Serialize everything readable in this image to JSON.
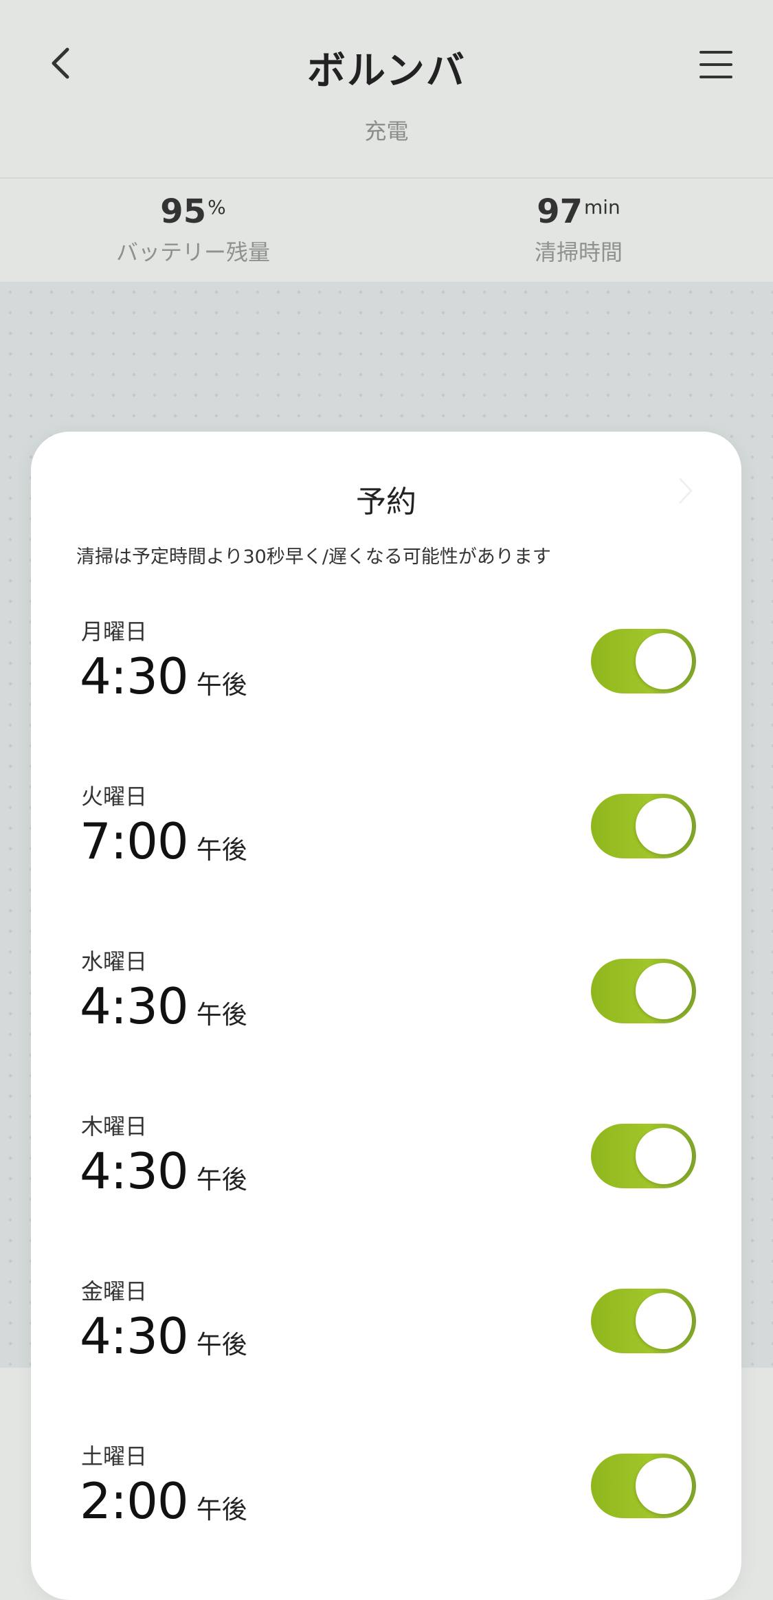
{
  "header": {
    "title": "ボルンバ",
    "subtitle": "充電"
  },
  "stats": {
    "battery": {
      "value": "95",
      "unit": "%",
      "label": "バッテリー残量"
    },
    "cleaning": {
      "value": "97",
      "unit": "min",
      "label": "清掃時間"
    }
  },
  "schedule": {
    "title": "予約",
    "note": "清掃は予定時間より30秒早く/遅くなる可能性があります",
    "items": [
      {
        "day": "月曜日",
        "time": "4:30",
        "ampm": "午後",
        "enabled": true
      },
      {
        "day": "火曜日",
        "time": "7:00",
        "ampm": "午後",
        "enabled": true
      },
      {
        "day": "水曜日",
        "time": "4:30",
        "ampm": "午後",
        "enabled": true
      },
      {
        "day": "木曜日",
        "time": "4:30",
        "ampm": "午後",
        "enabled": true
      },
      {
        "day": "金曜日",
        "time": "4:30",
        "ampm": "午後",
        "enabled": true
      },
      {
        "day": "土曜日",
        "time": "2:00",
        "ampm": "午後",
        "enabled": true
      }
    ]
  },
  "icons": {
    "back": "chevron-left-icon",
    "menu": "hamburger-menu-icon",
    "sheet_next": "chevron-right-icon"
  },
  "colors": {
    "accent": "#9ec325",
    "background": "#e3e5e3",
    "map": "#d4dad9"
  }
}
